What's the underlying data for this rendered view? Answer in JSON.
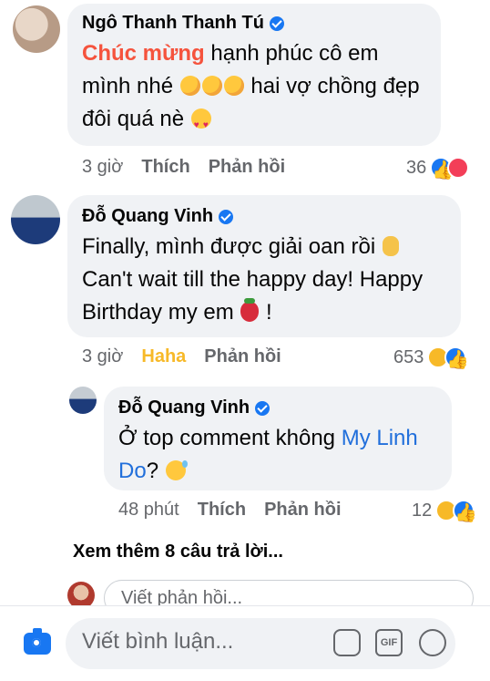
{
  "comments": [
    {
      "author": "Ngô Thanh Thanh Tú",
      "text_highlight": "Chúc mừng",
      "text_1": " hạnh phúc cô em",
      "text_2": "mình nhé ",
      "text_3": " hai vợ chồng đẹp",
      "text_4": "đôi quá nè ",
      "time": "3 giờ",
      "action_1": "Thích",
      "action_2": "Phản hồi",
      "reaction_count": "36"
    },
    {
      "author": "Đỗ Quang Vinh",
      "text_1": "Finally, mình được giải oan rồi ",
      "text_2": "Can't wait till the happy day! Happy",
      "text_3": "Birthday my em ",
      "text_4": " !",
      "time": "3 giờ",
      "action_1": "Haha",
      "action_2": "Phản hồi",
      "reaction_count": "653"
    },
    {
      "author": "Đỗ Quang Vinh",
      "text_1": "Ở top comment không ",
      "mention_1": "My Linh",
      "mention_2": "Do",
      "text_2": "? ",
      "time": "48 phút",
      "action_1": "Thích",
      "action_2": "Phản hồi",
      "reaction_count": "12"
    }
  ],
  "view_more": "Xem thêm 8 câu trả lời...",
  "reply_placeholder": "Viết phản hồi...",
  "comment_placeholder": "Viết bình luận...",
  "icons": [
    "camera-icon",
    "sticker-icon",
    "gif-icon",
    "emoji-icon",
    "verified-icon"
  ],
  "colors": {
    "accent": "#1877f2",
    "bubble": "#f0f2f5",
    "secondary_text": "#65676b",
    "haha": "#f7b928",
    "highlight": "#f5533d"
  }
}
